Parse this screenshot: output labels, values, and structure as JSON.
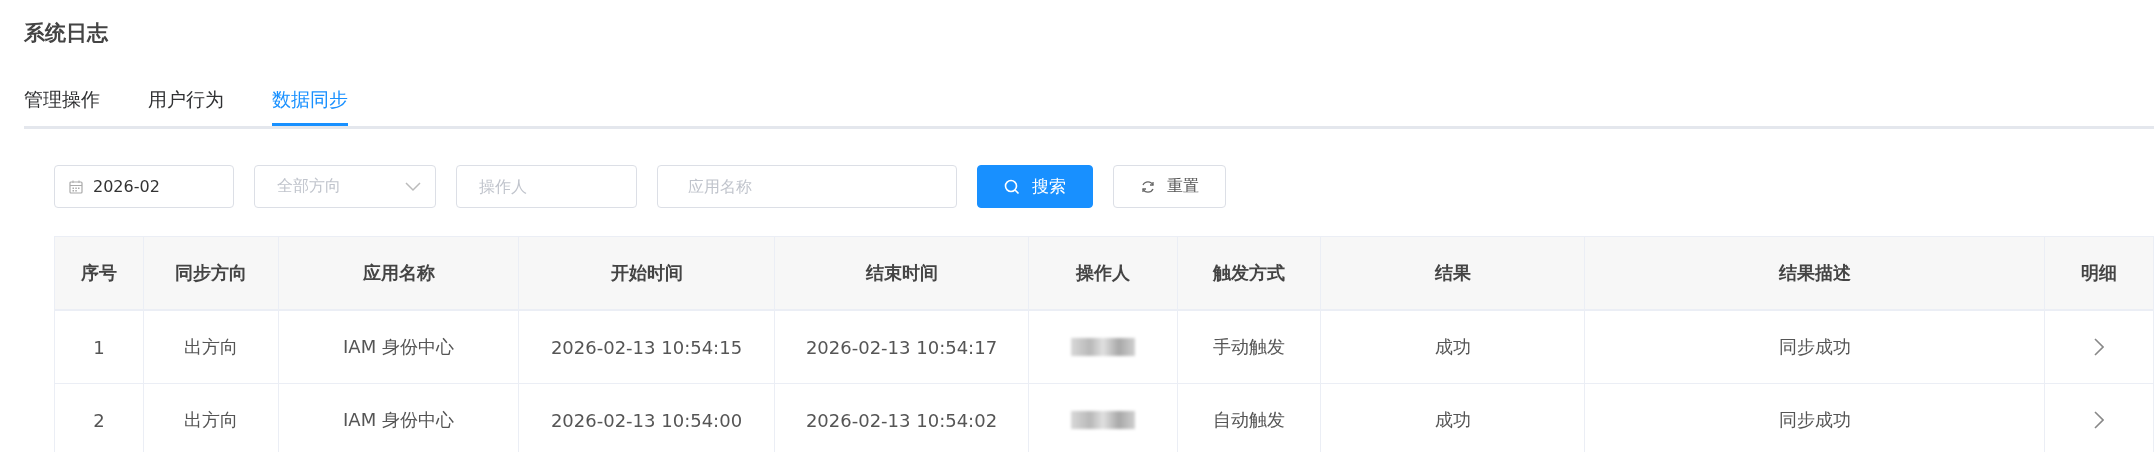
{
  "page_title": "系统日志",
  "tabs": [
    {
      "label": "管理操作",
      "selected": false
    },
    {
      "label": "用户行为",
      "selected": false
    },
    {
      "label": "数据同步",
      "selected": true
    }
  ],
  "filters": {
    "month": {
      "value": "2026-02"
    },
    "direction": {
      "placeholder": "全部方向"
    },
    "operator": {
      "placeholder": "操作人"
    },
    "app_name": {
      "placeholder": "应用名称"
    }
  },
  "buttons": [
    {
      "kind": "primary",
      "label": "搜索"
    },
    {
      "kind": "default",
      "label": "重置"
    }
  ],
  "table": {
    "columns": [
      "序号",
      "同步方向",
      "应用名称",
      "开始时间",
      "结束时间",
      "操作人",
      "触发方式",
      "结果",
      "结果描述",
      "明细"
    ],
    "rows": [
      {
        "index": "1",
        "direction": "出方向",
        "app": "IAM 身份中心",
        "start": "2026-02-13 10:54:15",
        "end": "2026-02-13 10:54:17",
        "operator_redacted": true,
        "trigger": "手动触发",
        "result": "成功",
        "description": "同步成功"
      },
      {
        "index": "2",
        "direction": "出方向",
        "app": "IAM 身份中心",
        "start": "2026-02-13 10:54:00",
        "end": "2026-02-13 10:54:02",
        "operator_redacted": true,
        "trigger": "自动触发",
        "result": "成功",
        "description": "同步成功"
      }
    ]
  }
}
